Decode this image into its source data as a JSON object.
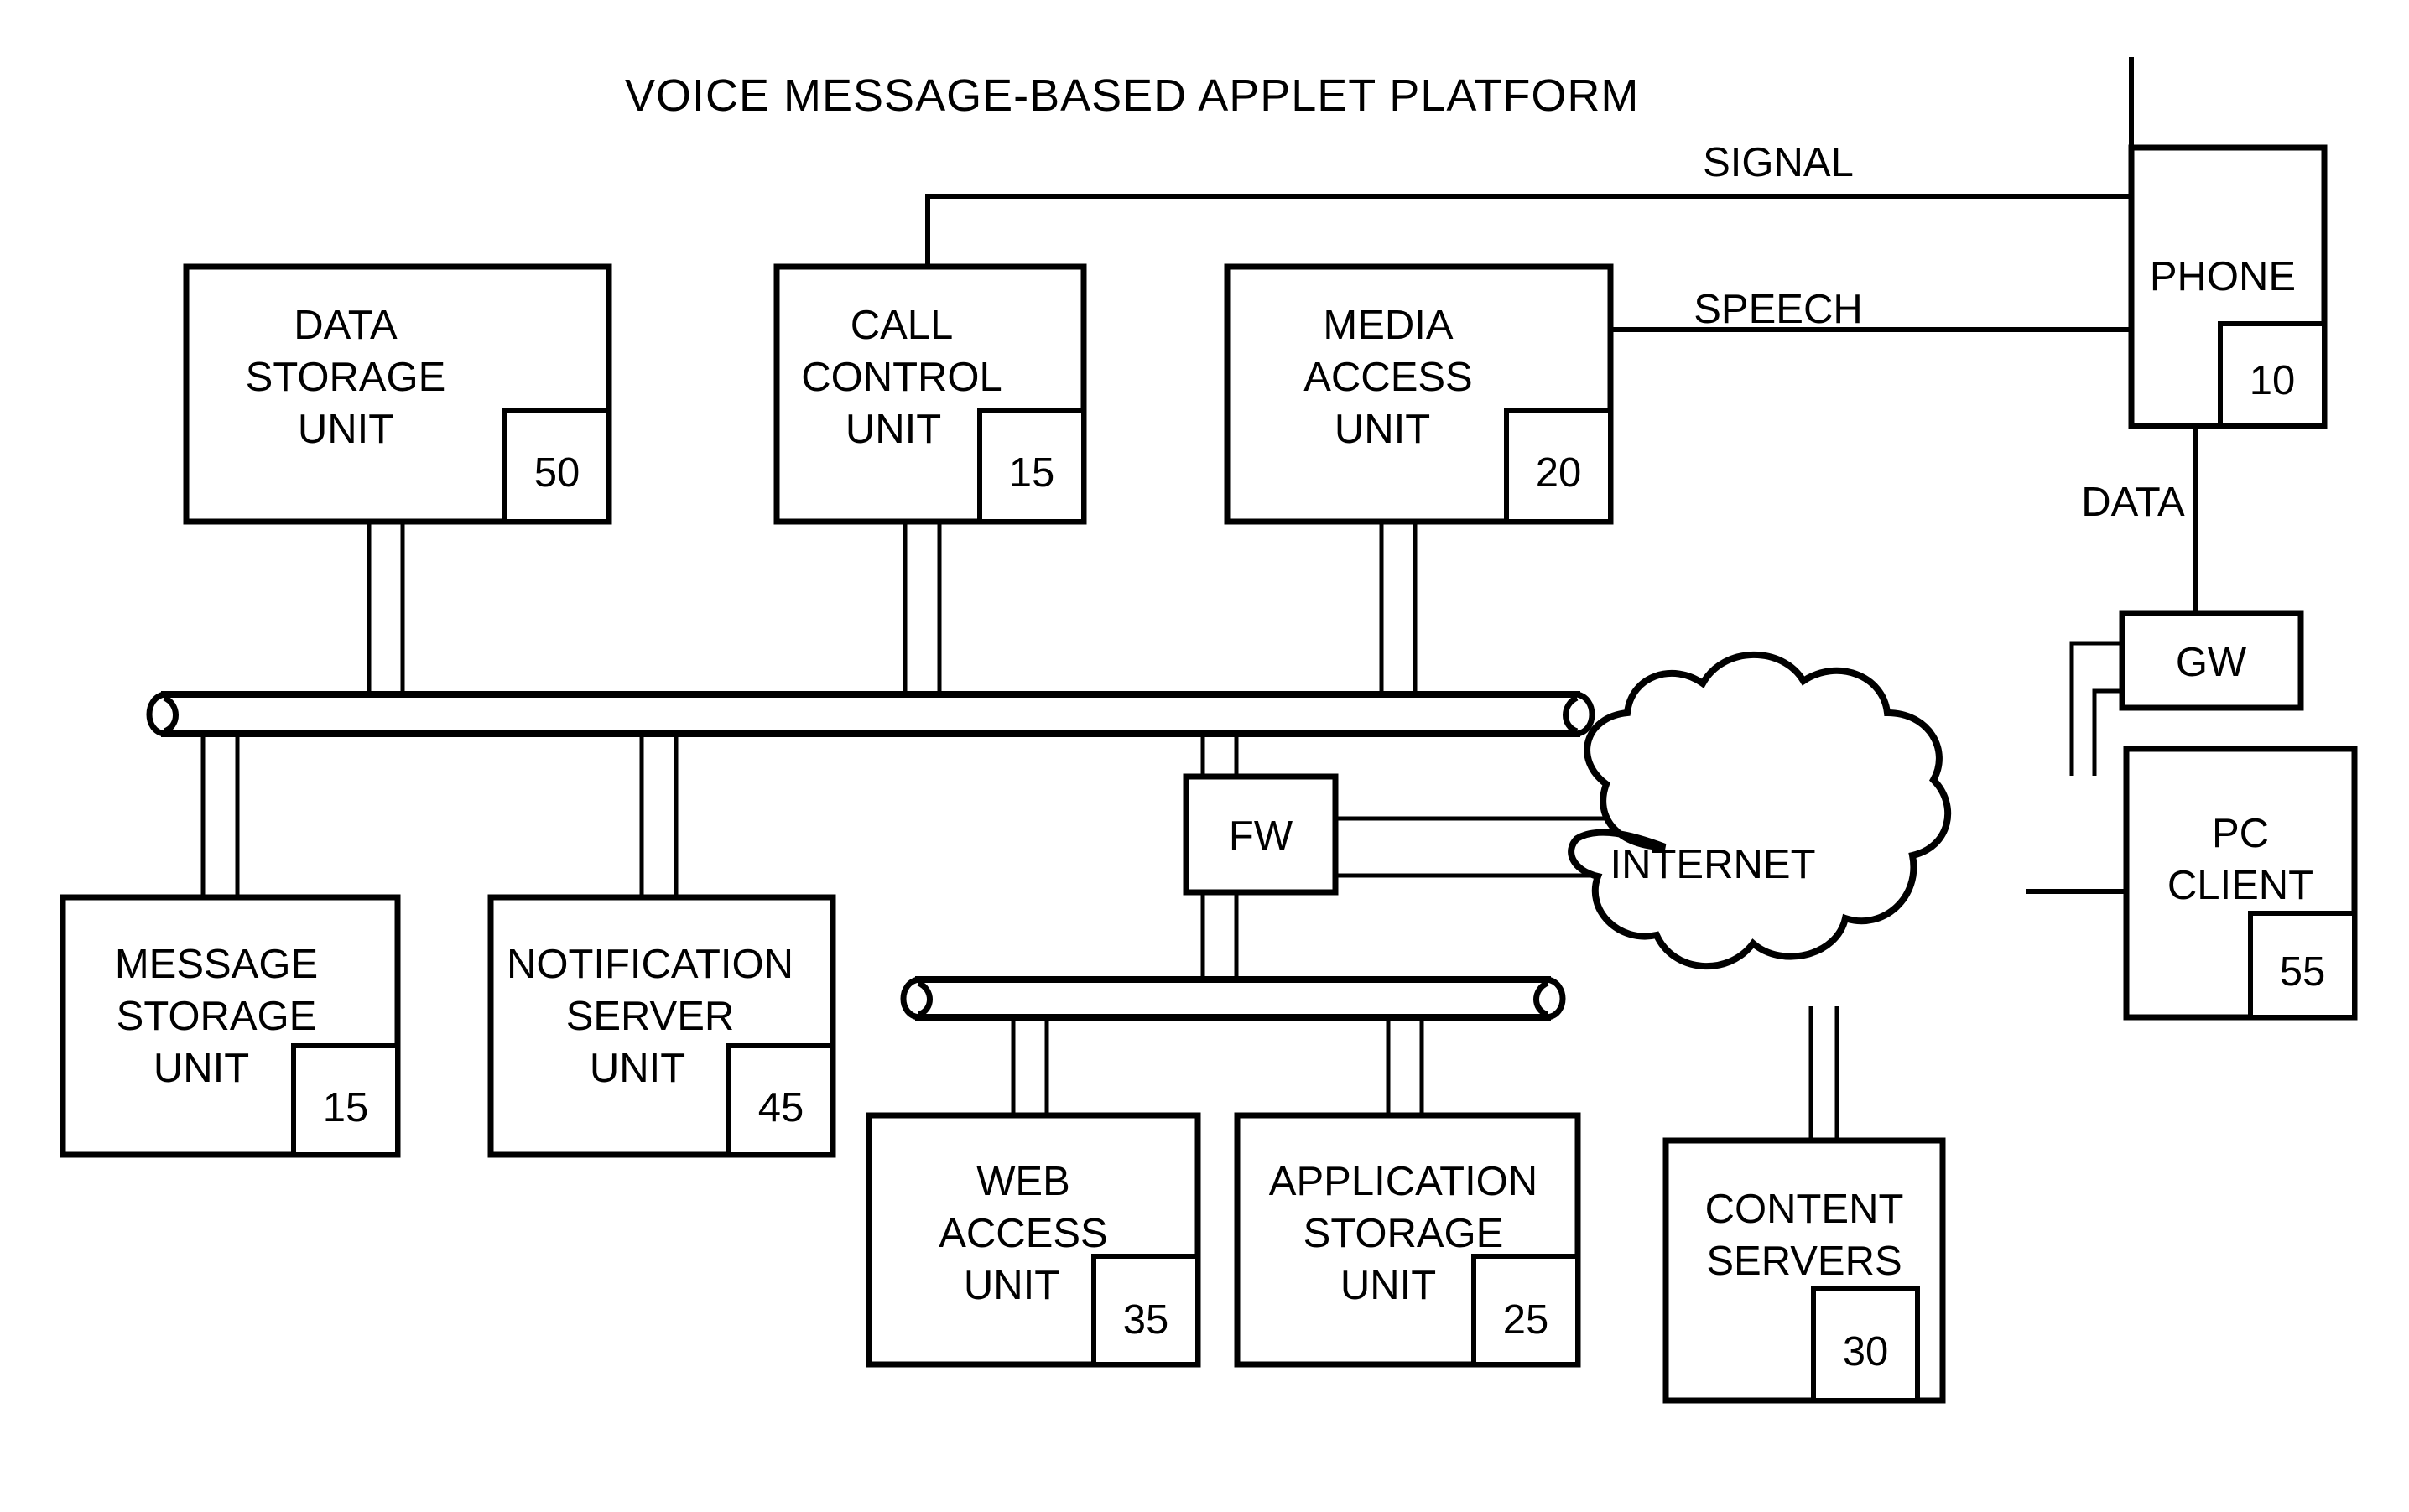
{
  "diagram": {
    "title": "VOICE MESSAGE-BASED APPLET PLATFORM",
    "type": "patent-block-diagram",
    "blocks": [
      {
        "id": "data_storage",
        "label_lines": [
          "DATA",
          "STORAGE",
          "UNIT"
        ],
        "ref": "50"
      },
      {
        "id": "call_control",
        "label_lines": [
          "CALL",
          "CONTROL",
          "UNIT"
        ],
        "ref": "15"
      },
      {
        "id": "media_access",
        "label_lines": [
          "MEDIA",
          "ACCESS",
          "UNIT"
        ],
        "ref": "20"
      },
      {
        "id": "phone",
        "label_lines": [
          "PHONE"
        ],
        "ref": "10"
      },
      {
        "id": "message_storage",
        "label_lines": [
          "MESSAGE",
          "STORAGE",
          "UNIT"
        ],
        "ref": "15"
      },
      {
        "id": "notification_server",
        "label_lines": [
          "NOTIFICATION",
          "SERVER",
          "UNIT"
        ],
        "ref": "45"
      },
      {
        "id": "web_access",
        "label_lines": [
          "WEB",
          "ACCESS",
          "UNIT"
        ],
        "ref": "35"
      },
      {
        "id": "application_storage",
        "label_lines": [
          "APPLICATION",
          "STORAGE",
          "UNIT"
        ],
        "ref": "25"
      },
      {
        "id": "content_servers",
        "label_lines": [
          "CONTENT",
          "SERVERS"
        ],
        "ref": "30"
      },
      {
        "id": "pc_client",
        "label_lines": [
          "PC",
          "CLIENT"
        ],
        "ref": "55"
      },
      {
        "id": "gateway",
        "label_lines": [
          "GW"
        ],
        "ref": ""
      },
      {
        "id": "firewall",
        "label_lines": [
          "FW"
        ],
        "ref": ""
      },
      {
        "id": "internet",
        "label_lines": [
          "INTERNET"
        ],
        "ref": ""
      }
    ],
    "labels": {
      "data_storage_l1": "DATA",
      "data_storage_l2": "STORAGE",
      "data_storage_l3": "UNIT",
      "data_storage_ref": "50",
      "call_control_l1": "CALL",
      "call_control_l2": "CONTROL",
      "call_control_l3": "UNIT",
      "call_control_ref": "15",
      "media_access_l1": "MEDIA",
      "media_access_l2": "ACCESS",
      "media_access_l3": "UNIT",
      "media_access_ref": "20",
      "phone_l1": "PHONE",
      "phone_ref": "10",
      "message_storage_l1": "MESSAGE",
      "message_storage_l2": "STORAGE",
      "message_storage_l3": "UNIT",
      "message_storage_ref": "15",
      "notification_l1": "NOTIFICATION",
      "notification_l2": "SERVER",
      "notification_l3": "UNIT",
      "notification_ref": "45",
      "web_access_l1": "WEB",
      "web_access_l2": "ACCESS",
      "web_access_l3": "UNIT",
      "web_access_ref": "35",
      "app_storage_l1": "APPLICATION",
      "app_storage_l2": "STORAGE",
      "app_storage_l3": "UNIT",
      "app_storage_ref": "25",
      "content_servers_l1": "CONTENT",
      "content_servers_l2": "SERVERS",
      "content_servers_ref": "30",
      "pc_client_l1": "PC",
      "pc_client_l2": "CLIENT",
      "pc_client_ref": "55",
      "gateway_l1": "GW",
      "firewall_l1": "FW",
      "internet_l1": "INTERNET"
    },
    "connection_labels": {
      "signal": "SIGNAL",
      "speech": "SPEECH",
      "data": "DATA"
    },
    "colors": {
      "line": "#000000",
      "fill": "#ffffff",
      "text": "#000000"
    }
  }
}
